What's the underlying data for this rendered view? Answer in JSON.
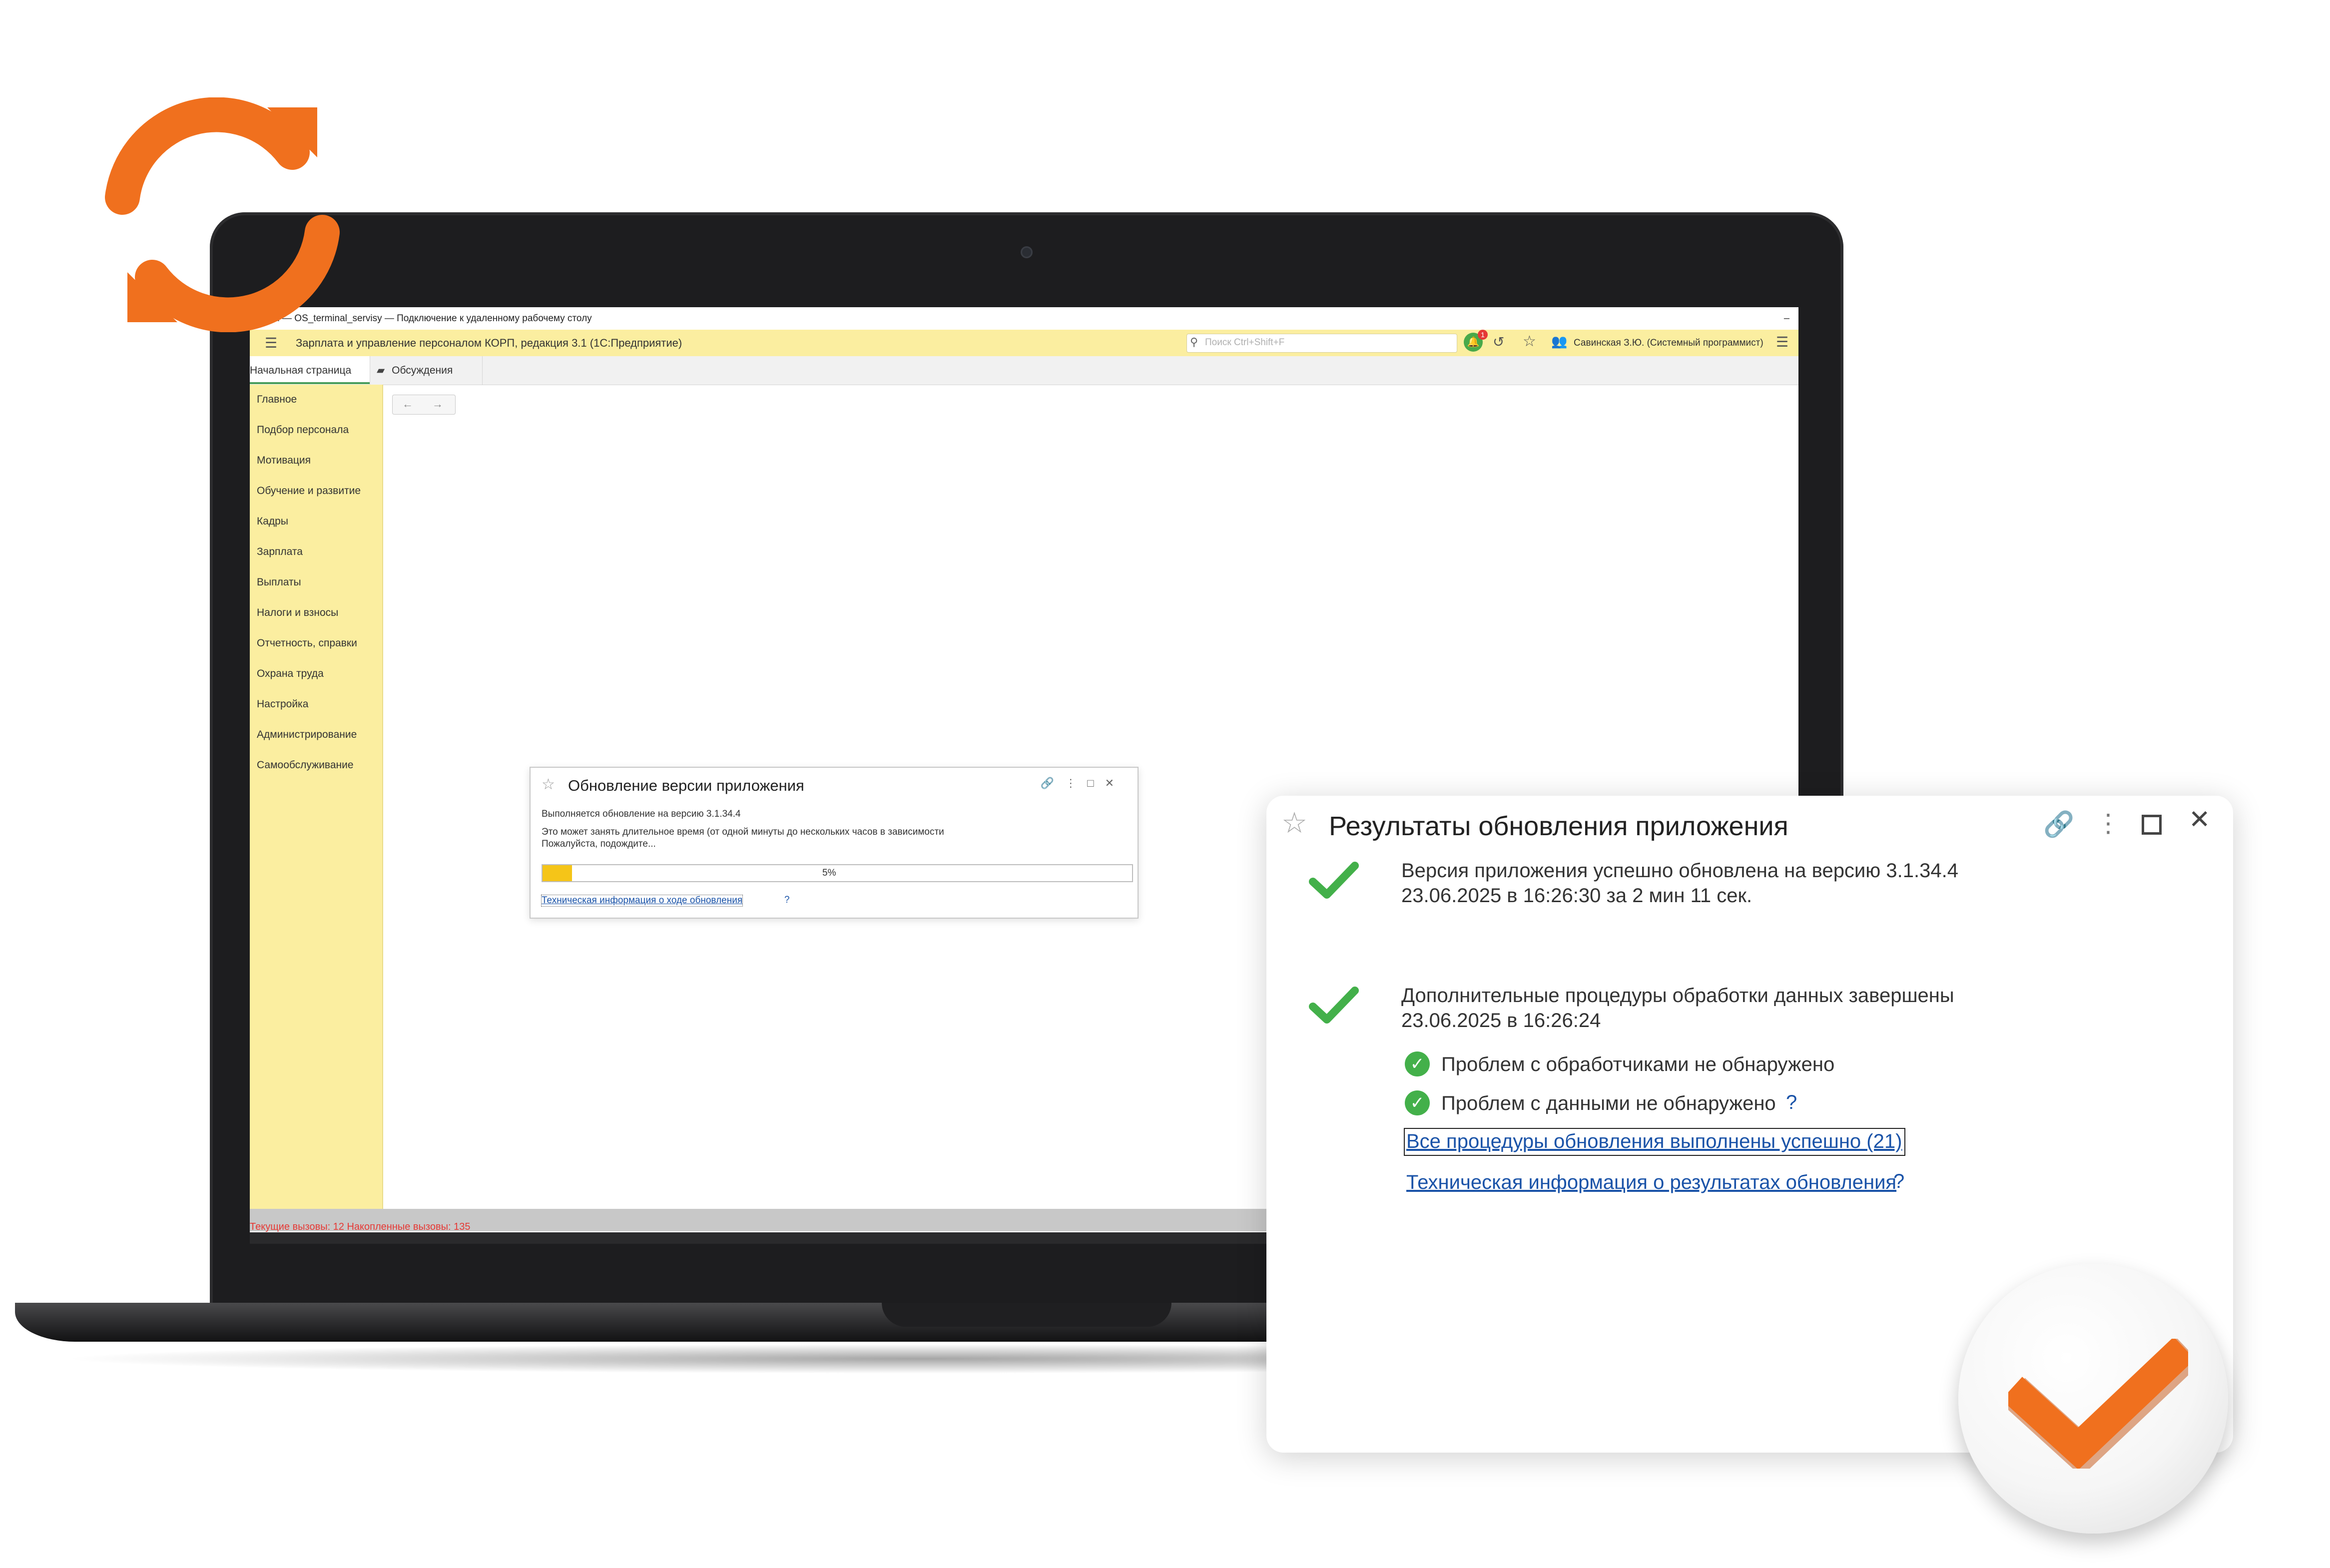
{
  "screen": {
    "window_title": "rminal — OS_terminal_servisy — Подключение к удаленному рабочему столу",
    "minimize_glyph": "–",
    "app_title": "Зарплата и управление персоналом КОРП, редакция 3.1  (1С:Предприятие)",
    "search_placeholder": "Поиск Ctrl+Shift+F",
    "notification_count": "1",
    "user_name": "Савинская З.Ю. (Системный программист)",
    "tabs": [
      "Начальная страница",
      "Обсуждения"
    ],
    "sidebar_items": [
      "Главное",
      "Подбор персонала",
      "Мотивация",
      "Обучение и развитие",
      "Кадры",
      "Зарплата",
      "Выплаты",
      "Налоги и взносы",
      "Отчетность, справки",
      "Охрана труда",
      "Настройка",
      "Администрирование",
      "Самообслуживание"
    ],
    "nav_back": "←",
    "nav_forward": "→",
    "status_text": "Текущие вызовы: 12   Накопленные вызовы: 135"
  },
  "small_dialog": {
    "title": "Обновление версии приложения",
    "line1": "Выполняется обновление на версию 3.1.34.4",
    "line2": "Это может занять длительное время (от одной минуты до нескольких часов в зависимости",
    "line3": "Пожалуйста, подождите...",
    "progress_label": "5%",
    "progress_value": 0.05,
    "link": "Техническая информация о ходе обновления",
    "help": "?"
  },
  "big_dialog": {
    "title": "Результаты обновления приложения",
    "result1_line1": "Версия приложения успешно обновлена на версию 3.1.34.4",
    "result1_line2": "23.06.2025 в 16:26:30 за 2 мин 11 сек.",
    "result2_line1": "Дополнительные процедуры обработки данных завершены",
    "result2_line2": "23.06.2025 в 16:26:24",
    "check1": "Проблем с обработчиками не обнаружено",
    "check2": "Проблем с данными не обнаружено",
    "help": "?",
    "link1": "Все процедуры обновления выполнены успешно (21)",
    "link2": "Техническая информация о результатах обновления"
  },
  "icons": {
    "refresh": "refresh-icon",
    "badge_check": "check-icon",
    "accent_orange": "#f0701e",
    "success_green": "#43b04a",
    "app_yellow": "#fbeea0",
    "link_blue": "#1a53a8"
  }
}
